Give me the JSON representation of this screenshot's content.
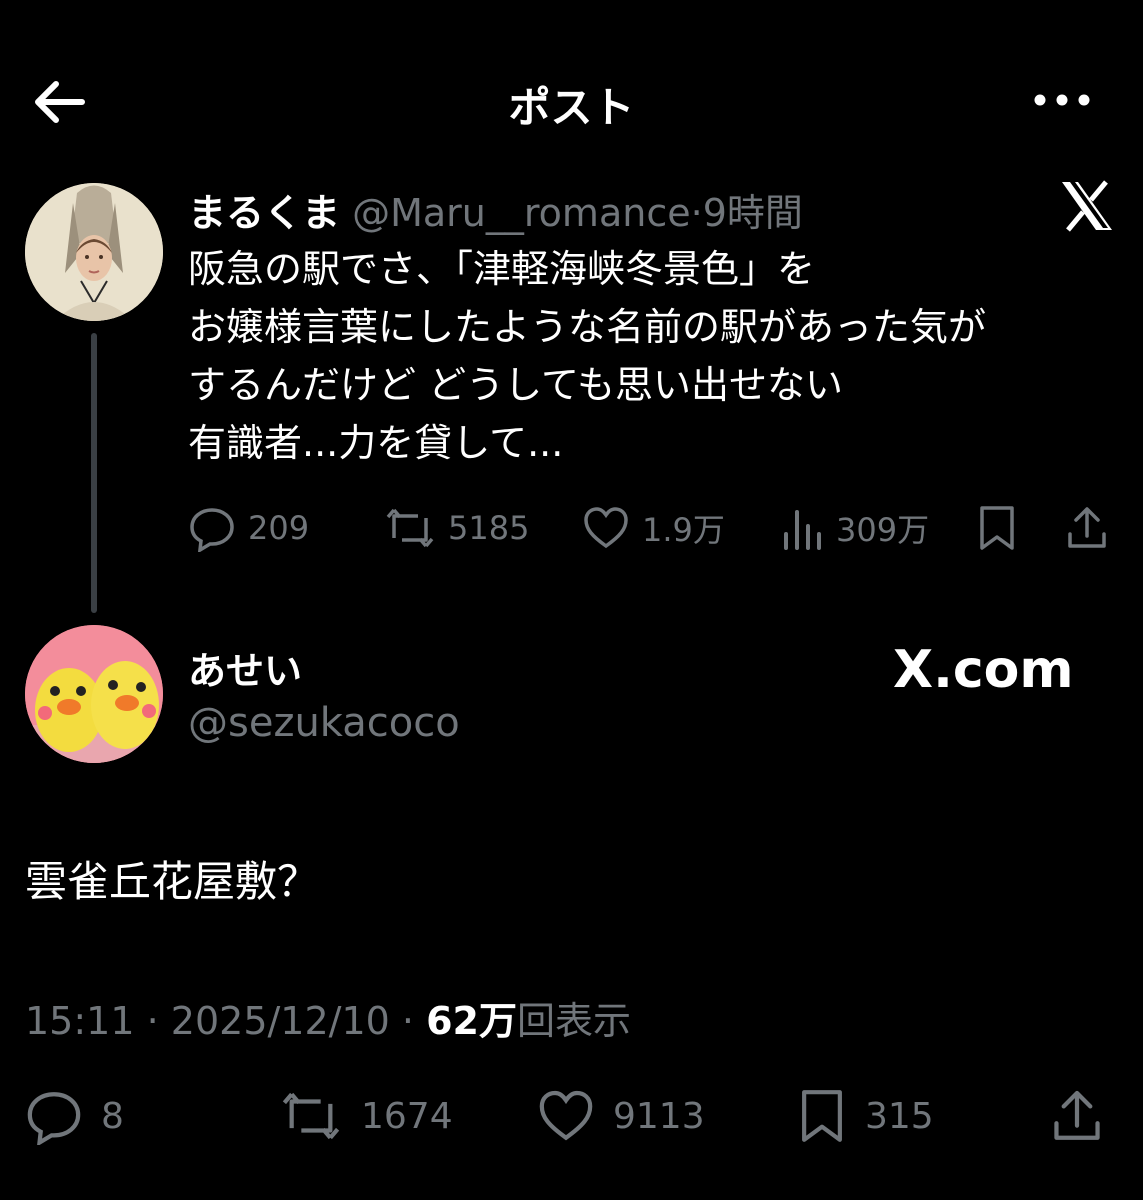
{
  "header": {
    "title": "ポスト",
    "back_icon": "back-arrow-icon",
    "more_icon": "more-dots-icon"
  },
  "parent_tweet": {
    "display_name": "まるくま",
    "handle": "@Maru__romance",
    "separator": "·",
    "time": "9時間",
    "lines": [
      "阪急の駅でさ、「津軽海峡冬景色」を",
      "お嬢様言葉にしたような名前の駅があった気が",
      "するんだけど どうしても思い出せない",
      "有識者...力を貸して..."
    ],
    "stats": {
      "replies": "209",
      "reposts": "5185",
      "likes": "1.9万",
      "views": "309万"
    },
    "icons": [
      "reply-icon",
      "repost-icon",
      "like-icon",
      "views-icon",
      "bookmark-icon",
      "share-icon",
      "x-logo-icon"
    ]
  },
  "reply_tweet": {
    "display_name": "あせい",
    "handle": "@sezukacoco",
    "watermark": "X.com",
    "text": "雲雀丘花屋敷？",
    "time": "15:11",
    "sep1": "·",
    "date": "2025/12/10",
    "sep2": "·",
    "views_count": "62万",
    "views_label": "回表示",
    "stats": {
      "replies": "8",
      "reposts": "1674",
      "likes": "9113",
      "bookmarks": "315"
    }
  },
  "colors": {
    "background": "#000000",
    "text": "#e7e9ea",
    "muted": "#71767b",
    "line": "#3a3f44"
  }
}
